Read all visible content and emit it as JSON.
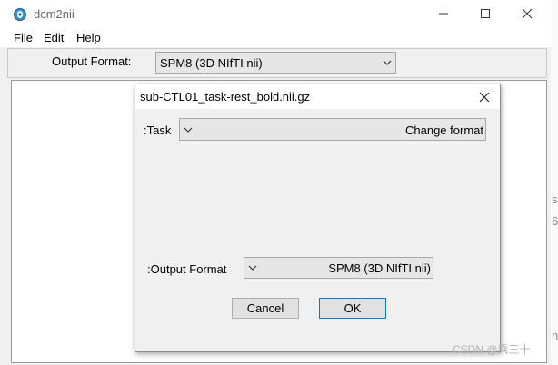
{
  "window": {
    "title": "dcm2nii",
    "icon": "dcm2nii-app-icon",
    "controls": [
      "minimize-icon",
      "maximize-icon",
      "close-icon"
    ]
  },
  "menu": {
    "file": "File",
    "edit": "Edit",
    "help": "Help"
  },
  "toolbar": {
    "output_format_label": "Output Format:",
    "output_format_value": "SPM8 (3D NIfTI nii)"
  },
  "background_fragments": {
    "a": "s",
    "b": "6",
    "c": "n"
  },
  "dialog": {
    "title": "sub-CTL01_task-rest_bold.nii.gz",
    "task_label": ":Task",
    "task_value": "Change format",
    "output_format_label": ":Output Format",
    "output_format_value": "SPM8 (3D NIfTI nii)",
    "cancel": "Cancel",
    "ok": "OK"
  },
  "watermark": "CSDN @乘三十"
}
